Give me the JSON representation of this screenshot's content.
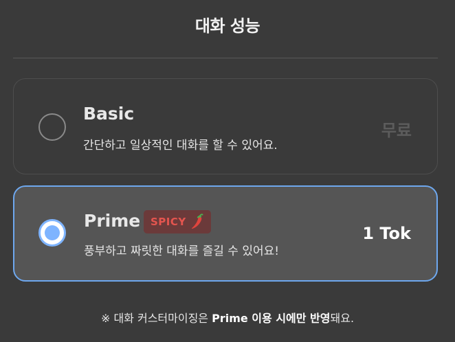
{
  "header": {
    "title": "대화 성능"
  },
  "options": [
    {
      "name": "Basic",
      "description": "간단하고 일상적인 대화를 할 수 있어요.",
      "price": "무료",
      "selected": false
    },
    {
      "name": "Prime",
      "badge": "SPICY",
      "badge_icon": "chili-pepper-icon",
      "description": "풍부하고 짜릿한 대화를 즐길 수 있어요!",
      "price": "1 Tok",
      "selected": true
    }
  ],
  "footnote": {
    "prefix": "※ 대화 커스터마이징은 ",
    "emphasis": "Prime 이용 시에만 반영",
    "suffix": "돼요."
  },
  "colors": {
    "background": "#3a3a3a",
    "selected_border": "#6ea8ef",
    "radio_accent": "#7eb4ff",
    "badge_bg": "#6b3a3a",
    "badge_text": "#e5554f"
  }
}
